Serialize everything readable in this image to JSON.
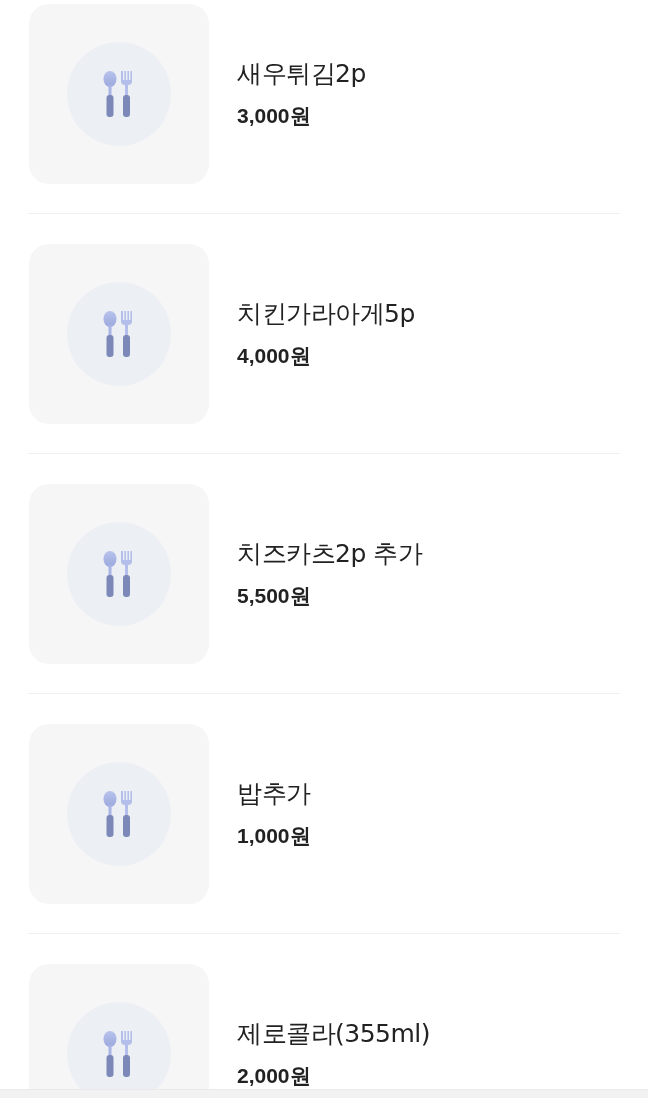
{
  "menu_items": [
    {
      "name": "새우튀김2p",
      "price": "3,000원"
    },
    {
      "name": "치킨가라아게5p",
      "price": "4,000원"
    },
    {
      "name": "치즈카츠2p 추가",
      "price": "5,500원"
    },
    {
      "name": "밥추가",
      "price": "1,000원"
    },
    {
      "name": "제로콜라(355ml)",
      "price": "2,000원"
    }
  ]
}
